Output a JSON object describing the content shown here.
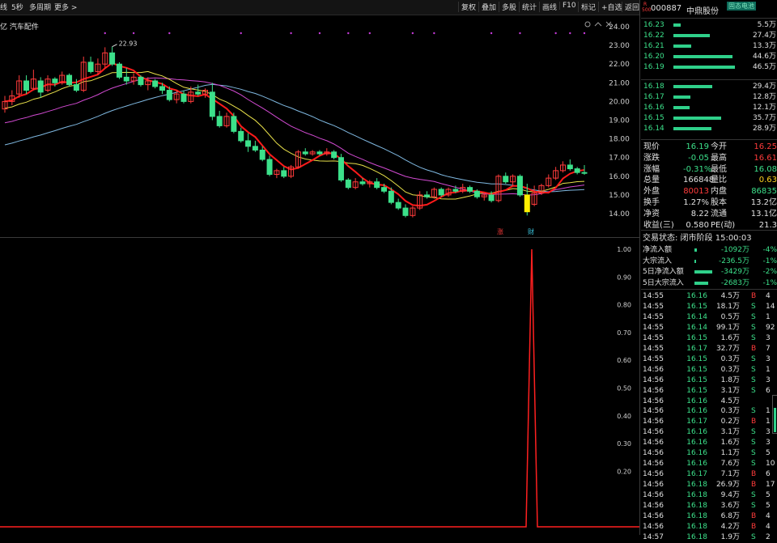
{
  "toolbar": {
    "left": [
      "线",
      "5秒",
      "多周期",
      "更多 >"
    ],
    "right": [
      "复权",
      "叠加",
      "多股",
      "统计",
      "画线",
      "F10",
      "标记",
      "+自选",
      "返回"
    ],
    "icons": [
      "settings-icon",
      "chevron-up-icon",
      "close-icon"
    ]
  },
  "sector": "亿 汽车配件",
  "stock": {
    "badge_top": "R",
    "badge_bottom": "500",
    "code": "000887",
    "name": "中鼎股份",
    "tag": "固态电池"
  },
  "price_axis": [
    "24.00",
    "23.00",
    "22.00",
    "21.00",
    "20.00",
    "19.00",
    "18.00",
    "17.00",
    "16.00",
    "15.00",
    "14.00"
  ],
  "high_label": "22.93",
  "markers": [
    {
      "text": "涨",
      "color": "#ff3b3b"
    },
    {
      "text": "财",
      "color": "#3cc7e0"
    }
  ],
  "lower_axis": [
    "1.00",
    "0.90",
    "0.80",
    "0.70",
    "0.60",
    "0.50",
    "0.40",
    "0.30",
    "0.20"
  ],
  "asks": [
    {
      "price": "16.23",
      "vol": "5.5万",
      "level": 0.12
    },
    {
      "price": "16.22",
      "vol": "27.4万",
      "level": 0.59
    },
    {
      "price": "16.21",
      "vol": "13.3万",
      "level": 0.29
    },
    {
      "price": "16.20",
      "vol": "44.6万",
      "level": 0.96
    },
    {
      "price": "16.19",
      "vol": "46.5万",
      "level": 1.0
    }
  ],
  "bids": [
    {
      "price": "16.18",
      "vol": "29.4万",
      "level": 0.63
    },
    {
      "price": "16.17",
      "vol": "12.8万",
      "level": 0.28
    },
    {
      "price": "16.16",
      "vol": "12.1万",
      "level": 0.26
    },
    {
      "price": "16.15",
      "vol": "35.7万",
      "level": 0.77
    },
    {
      "price": "16.14",
      "vol": "28.9万",
      "level": 0.62
    }
  ],
  "quote": [
    {
      "l1": "现价",
      "v1": "16.19",
      "c1": "green",
      "l2": "今开",
      "v2": "16.25",
      "c2": "red"
    },
    {
      "l1": "涨跌",
      "v1": "-0.05",
      "c1": "green",
      "l2": "最高",
      "v2": "16.61",
      "c2": "red"
    },
    {
      "l1": "涨幅",
      "v1": "-0.31%",
      "c1": "green",
      "l2": "最低",
      "v2": "16.08",
      "c2": "green"
    },
    {
      "l1": "总量",
      "v1": "166848",
      "c1": "white",
      "l2": "量比",
      "v2": "0.63",
      "c2": "yellow"
    },
    {
      "l1": "外盘",
      "v1": "80013",
      "c1": "red",
      "l2": "内盘",
      "v2": "86835",
      "c2": "green"
    },
    {
      "l1": "换手",
      "v1": "1.27%",
      "c1": "white",
      "l2": "股本",
      "v2": "13.2亿",
      "c2": "white"
    },
    {
      "l1": "净资",
      "v1": "8.22",
      "c1": "white",
      "l2": "流通",
      "v2": "13.1亿",
      "c2": "white"
    },
    {
      "l1": "收益(三)",
      "v1": "0.580",
      "c1": "white",
      "l2": "PE(动)",
      "v2": "21.3",
      "c2": "white"
    }
  ],
  "status": "交易状态: 闭市阶段 15:00:03",
  "flows": [
    {
      "label": "净流入额",
      "value": "-1092万",
      "pct": "-4%",
      "level": 0.12
    },
    {
      "label": "大宗流入",
      "value": "-236.5万",
      "pct": "-1%",
      "level": 0.03
    },
    {
      "label": "5日净流入额",
      "value": "-3429万",
      "pct": "-2%",
      "level": 1.0
    },
    {
      "label": "5日大宗流入",
      "value": "-2683万",
      "pct": "-1%",
      "level": 0.78
    }
  ],
  "ticks": [
    {
      "time": "14:55",
      "price": "16.16",
      "vol": "4.5万",
      "side": "B",
      "n": "4"
    },
    {
      "time": "14:55",
      "price": "16.15",
      "vol": "18.1万",
      "side": "S",
      "n": "14"
    },
    {
      "time": "14:55",
      "price": "16.14",
      "vol": "0.5万",
      "side": "S",
      "n": "1"
    },
    {
      "time": "14:55",
      "price": "16.14",
      "vol": "99.1万",
      "side": "S",
      "n": "92"
    },
    {
      "time": "14:55",
      "price": "16.15",
      "vol": "1.6万",
      "side": "S",
      "n": "3"
    },
    {
      "time": "14:55",
      "price": "16.17",
      "vol": "32.7万",
      "side": "B",
      "n": "7"
    },
    {
      "time": "14:55",
      "price": "16.15",
      "vol": "0.3万",
      "side": "S",
      "n": "3"
    },
    {
      "time": "14:56",
      "price": "16.15",
      "vol": "0.3万",
      "side": "S",
      "n": "1"
    },
    {
      "time": "14:56",
      "price": "16.15",
      "vol": "1.8万",
      "side": "S",
      "n": "3"
    },
    {
      "time": "14:56",
      "price": "16.15",
      "vol": "3.1万",
      "side": "S",
      "n": "6"
    },
    {
      "time": "14:56",
      "price": "16.16",
      "vol": "4.5万",
      "side": "",
      "n": ""
    },
    {
      "time": "14:56",
      "price": "16.16",
      "vol": "0.3万",
      "side": "S",
      "n": "1"
    },
    {
      "time": "14:56",
      "price": "16.17",
      "vol": "0.2万",
      "side": "B",
      "n": "1"
    },
    {
      "time": "14:56",
      "price": "16.16",
      "vol": "3.1万",
      "side": "S",
      "n": "3"
    },
    {
      "time": "14:56",
      "price": "16.16",
      "vol": "1.6万",
      "side": "S",
      "n": "3"
    },
    {
      "time": "14:56",
      "price": "16.16",
      "vol": "1.1万",
      "side": "S",
      "n": "5"
    },
    {
      "time": "14:56",
      "price": "16.16",
      "vol": "7.6万",
      "side": "S",
      "n": "10"
    },
    {
      "time": "14:56",
      "price": "16.17",
      "vol": "7.1万",
      "side": "B",
      "n": "6"
    },
    {
      "time": "14:56",
      "price": "16.18",
      "vol": "26.9万",
      "side": "B",
      "n": "17"
    },
    {
      "time": "14:56",
      "price": "16.18",
      "vol": "9.4万",
      "side": "S",
      "n": "5"
    },
    {
      "time": "14:56",
      "price": "16.18",
      "vol": "3.6万",
      "side": "S",
      "n": "5"
    },
    {
      "time": "14:56",
      "price": "16.18",
      "vol": "6.8万",
      "side": "B",
      "n": "4"
    },
    {
      "time": "14:56",
      "price": "16.18",
      "vol": "4.2万",
      "side": "B",
      "n": "4"
    },
    {
      "time": "14:57",
      "price": "16.18",
      "vol": "1.9万",
      "side": "S",
      "n": "2"
    }
  ],
  "colors": {
    "up": "#ff3b3b",
    "down": "#3ce08a",
    "ma5": "#ff1a1a",
    "ma10": "#e8e04a",
    "ma20": "#d14ad1",
    "ma60": "#7fb8e0",
    "bg": "#000000"
  },
  "chart_data": {
    "type": "candlestick",
    "ylim": [
      13.5,
      24.3
    ],
    "candles": [
      [
        19.6,
        20.3,
        19.4,
        20.0
      ],
      [
        20.0,
        20.6,
        19.8,
        20.3
      ],
      [
        20.4,
        21.4,
        20.2,
        21.1
      ],
      [
        21.1,
        21.4,
        20.4,
        20.6
      ],
      [
        20.7,
        21.7,
        20.6,
        21.2
      ],
      [
        21.1,
        21.3,
        20.2,
        20.5
      ],
      [
        20.6,
        21.4,
        20.5,
        21.2
      ],
      [
        21.2,
        21.3,
        20.8,
        21.0
      ],
      [
        21.0,
        21.6,
        20.9,
        21.4
      ],
      [
        21.4,
        21.5,
        20.8,
        20.9
      ],
      [
        20.9,
        21.2,
        20.5,
        20.6
      ],
      [
        20.6,
        22.4,
        20.5,
        22.1
      ],
      [
        22.1,
        22.4,
        21.5,
        21.6
      ],
      [
        21.6,
        22.3,
        21.4,
        22.0
      ],
      [
        22.0,
        22.9,
        21.8,
        22.6
      ],
      [
        22.6,
        22.93,
        21.9,
        22.0
      ],
      [
        22.0,
        22.1,
        21.2,
        21.3
      ],
      [
        21.3,
        21.8,
        20.9,
        21.1
      ],
      [
        21.1,
        21.5,
        20.9,
        21.3
      ],
      [
        21.3,
        21.4,
        20.8,
        20.9
      ],
      [
        20.9,
        21.3,
        20.6,
        21.1
      ],
      [
        21.1,
        21.2,
        20.7,
        20.8
      ],
      [
        20.8,
        21.0,
        20.4,
        20.6
      ],
      [
        20.6,
        20.8,
        20.0,
        20.1
      ],
      [
        20.1,
        20.6,
        19.9,
        20.4
      ],
      [
        20.4,
        20.6,
        19.9,
        20.0
      ],
      [
        20.0,
        20.8,
        19.9,
        20.5
      ],
      [
        20.5,
        20.9,
        20.3,
        20.4
      ],
      [
        20.4,
        20.7,
        20.2,
        20.6
      ],
      [
        20.5,
        21.0,
        19.0,
        19.2
      ],
      [
        19.2,
        19.5,
        18.6,
        18.7
      ],
      [
        18.7,
        19.4,
        18.6,
        19.2
      ],
      [
        19.2,
        19.4,
        18.3,
        18.4
      ],
      [
        18.4,
        18.6,
        17.8,
        17.9
      ],
      [
        17.9,
        18.3,
        17.3,
        17.6
      ],
      [
        17.6,
        17.9,
        17.3,
        17.4
      ],
      [
        17.4,
        17.6,
        16.8,
        16.9
      ],
      [
        16.9,
        17.1,
        16.0,
        16.1
      ],
      [
        16.1,
        16.4,
        15.9,
        16.3
      ],
      [
        16.3,
        16.5,
        15.9,
        16.0
      ],
      [
        16.0,
        16.6,
        15.9,
        16.5
      ],
      [
        16.5,
        17.4,
        16.4,
        17.3
      ],
      [
        17.3,
        17.5,
        17.1,
        17.2
      ],
      [
        17.2,
        17.4,
        17.1,
        17.3
      ],
      [
        17.3,
        17.4,
        17.1,
        17.2
      ],
      [
        17.2,
        17.5,
        17.1,
        17.3
      ],
      [
        17.3,
        17.4,
        16.9,
        17.0
      ],
      [
        17.0,
        17.2,
        15.7,
        15.8
      ],
      [
        15.8,
        15.9,
        15.3,
        15.4
      ],
      [
        15.4,
        15.9,
        15.3,
        15.7
      ],
      [
        15.7,
        15.9,
        15.5,
        15.6
      ],
      [
        15.6,
        15.8,
        15.4,
        15.7
      ],
      [
        15.7,
        15.9,
        15.3,
        15.4
      ],
      [
        15.4,
        15.6,
        15.1,
        15.2
      ],
      [
        15.2,
        15.4,
        14.5,
        14.6
      ],
      [
        14.6,
        14.8,
        14.2,
        14.3
      ],
      [
        14.3,
        14.5,
        13.8,
        13.9
      ],
      [
        13.9,
        14.4,
        13.8,
        14.3
      ],
      [
        14.3,
        15.2,
        14.2,
        15.0
      ],
      [
        15.0,
        15.2,
        14.8,
        14.9
      ],
      [
        14.9,
        15.4,
        14.8,
        15.3
      ],
      [
        15.3,
        15.4,
        14.9,
        15.0
      ],
      [
        15.0,
        15.4,
        14.9,
        15.3
      ],
      [
        15.3,
        15.5,
        15.1,
        15.2
      ],
      [
        15.2,
        15.6,
        15.1,
        15.4
      ],
      [
        15.4,
        15.5,
        15.1,
        15.2
      ],
      [
        15.2,
        15.3,
        14.8,
        14.9
      ],
      [
        14.9,
        15.1,
        14.7,
        15.0
      ],
      [
        15.0,
        15.2,
        14.6,
        14.7
      ],
      [
        14.7,
        16.1,
        14.6,
        16.0
      ],
      [
        16.0,
        16.2,
        15.6,
        15.7
      ],
      [
        15.7,
        16.1,
        15.5,
        16.0
      ],
      [
        16.0,
        16.1,
        14.9,
        15.0
      ],
      [
        15.0,
        15.6,
        13.9,
        14.1
      ],
      [
        14.5,
        15.5,
        14.4,
        15.1
      ],
      [
        15.1,
        15.6,
        15.0,
        15.5
      ],
      [
        15.5,
        16.1,
        15.4,
        15.9
      ],
      [
        15.9,
        16.5,
        15.8,
        16.3
      ],
      [
        16.3,
        16.8,
        16.2,
        16.6
      ],
      [
        16.6,
        16.9,
        16.3,
        16.4
      ],
      [
        16.4,
        16.5,
        16.1,
        16.2
      ],
      [
        16.2,
        16.6,
        16.08,
        16.19
      ]
    ],
    "lower_series": {
      "ylim": [
        0,
        1.0
      ],
      "spike_index": 73,
      "spike_value": 1.0
    }
  }
}
